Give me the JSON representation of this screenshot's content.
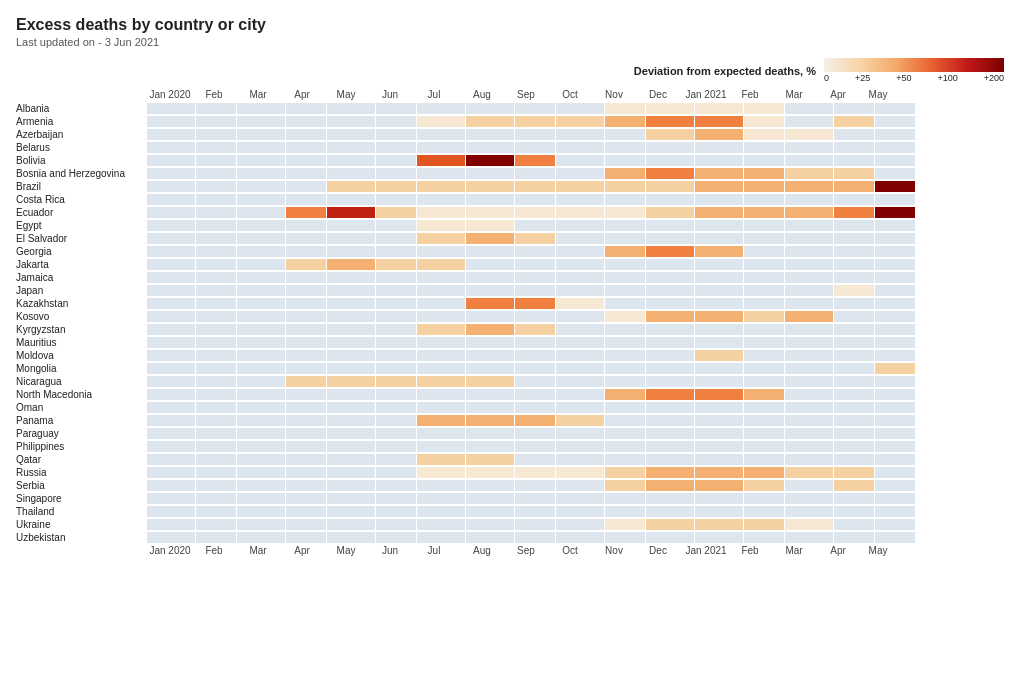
{
  "title": "Excess deaths by country or city",
  "subtitle": "Last updated on -  3 Jun 2021",
  "legend": {
    "title": "Deviation from expected deaths, %",
    "ticks": [
      "0",
      "+25",
      "+50",
      "+100",
      "+200"
    ]
  },
  "months": [
    {
      "label": "Jan 2020",
      "width": 48
    },
    {
      "label": "Feb",
      "width": 40
    },
    {
      "label": "Mar",
      "width": 48
    },
    {
      "label": "Apr",
      "width": 40
    },
    {
      "label": "May",
      "width": 48
    },
    {
      "label": "Jun",
      "width": 40
    },
    {
      "label": "Jul",
      "width": 48
    },
    {
      "label": "Aug",
      "width": 48
    },
    {
      "label": "Sep",
      "width": 40
    },
    {
      "label": "Oct",
      "width": 48
    },
    {
      "label": "Nov",
      "width": 40
    },
    {
      "label": "Dec",
      "width": 48
    },
    {
      "label": "Jan 2021",
      "width": 48
    },
    {
      "label": "Feb",
      "width": 40
    },
    {
      "label": "Mar",
      "width": 48
    },
    {
      "label": "Apr",
      "width": 40
    },
    {
      "label": "May",
      "width": 40
    }
  ],
  "countries": [
    {
      "name": "Albania",
      "cells": [
        0,
        0,
        0,
        0,
        0,
        0,
        0,
        0,
        0,
        0,
        5,
        15,
        20,
        10,
        0,
        0,
        0
      ]
    },
    {
      "name": "Armenia",
      "cells": [
        0,
        0,
        0,
        0,
        0,
        0,
        20,
        30,
        30,
        25,
        60,
        90,
        80,
        20,
        0,
        40,
        0
      ]
    },
    {
      "name": "Azerbaijan",
      "cells": [
        0,
        0,
        0,
        0,
        0,
        0,
        0,
        0,
        0,
        0,
        0,
        30,
        50,
        20,
        15,
        0,
        0
      ]
    },
    {
      "name": "Belarus",
      "cells": [
        0,
        0,
        0,
        0,
        0,
        0,
        0,
        0,
        0,
        0,
        0,
        0,
        0,
        0,
        0,
        0,
        0
      ]
    },
    {
      "name": "Bolivia",
      "cells": [
        0,
        0,
        0,
        0,
        0,
        0,
        110,
        170,
        80,
        0,
        0,
        0,
        0,
        0,
        0,
        0,
        0
      ]
    },
    {
      "name": "Bosnia and Herzegovina",
      "cells": [
        0,
        0,
        0,
        0,
        0,
        0,
        0,
        0,
        0,
        0,
        60,
        80,
        70,
        50,
        40,
        30,
        0
      ]
    },
    {
      "name": "Brazil",
      "cells": [
        0,
        0,
        0,
        0,
        25,
        30,
        30,
        30,
        30,
        30,
        35,
        40,
        50,
        55,
        60,
        65,
        200
      ]
    },
    {
      "name": "Costa Rica",
      "cells": [
        0,
        0,
        0,
        0,
        0,
        0,
        0,
        0,
        0,
        0,
        0,
        0,
        0,
        0,
        0,
        0,
        0
      ]
    },
    {
      "name": "Ecuador",
      "cells": [
        0,
        0,
        0,
        100,
        160,
        40,
        20,
        15,
        10,
        10,
        10,
        30,
        50,
        60,
        70,
        80,
        200
      ]
    },
    {
      "name": "Egypt",
      "cells": [
        0,
        0,
        0,
        0,
        0,
        0,
        20,
        10,
        0,
        0,
        0,
        0,
        0,
        0,
        0,
        0,
        0
      ]
    },
    {
      "name": "El Salvador",
      "cells": [
        0,
        0,
        0,
        0,
        0,
        0,
        40,
        60,
        30,
        0,
        0,
        0,
        0,
        0,
        0,
        0,
        0
      ]
    },
    {
      "name": "Georgia",
      "cells": [
        0,
        0,
        0,
        0,
        0,
        0,
        0,
        0,
        0,
        0,
        60,
        90,
        60,
        0,
        0,
        0,
        0
      ]
    },
    {
      "name": "Jakarta",
      "cells": [
        0,
        0,
        0,
        30,
        50,
        40,
        30,
        0,
        0,
        0,
        0,
        0,
        0,
        0,
        0,
        0,
        0
      ]
    },
    {
      "name": "Jamaica",
      "cells": [
        0,
        0,
        0,
        0,
        0,
        0,
        0,
        0,
        0,
        0,
        0,
        0,
        0,
        0,
        0,
        0,
        0
      ]
    },
    {
      "name": "Japan",
      "cells": [
        0,
        0,
        0,
        0,
        0,
        0,
        0,
        0,
        0,
        0,
        0,
        0,
        0,
        0,
        0,
        15,
        0
      ]
    },
    {
      "name": "Kazakhstan",
      "cells": [
        0,
        0,
        0,
        0,
        0,
        0,
        0,
        90,
        80,
        20,
        0,
        0,
        0,
        0,
        0,
        0,
        0
      ]
    },
    {
      "name": "Kosovo",
      "cells": [
        0,
        0,
        0,
        0,
        0,
        0,
        0,
        0,
        0,
        0,
        20,
        60,
        50,
        40,
        50,
        0,
        0
      ]
    },
    {
      "name": "Kyrgyzstan",
      "cells": [
        0,
        0,
        0,
        0,
        0,
        0,
        30,
        60,
        30,
        0,
        0,
        0,
        0,
        0,
        0,
        0,
        0
      ]
    },
    {
      "name": "Mauritius",
      "cells": [
        0,
        0,
        0,
        0,
        0,
        0,
        0,
        0,
        0,
        0,
        0,
        0,
        0,
        0,
        0,
        0,
        0
      ]
    },
    {
      "name": "Moldova",
      "cells": [
        0,
        0,
        0,
        0,
        0,
        0,
        0,
        0,
        0,
        0,
        0,
        0,
        30,
        0,
        0,
        0,
        0
      ]
    },
    {
      "name": "Mongolia",
      "cells": [
        0,
        0,
        0,
        0,
        0,
        0,
        0,
        0,
        0,
        0,
        0,
        0,
        0,
        0,
        0,
        0,
        40
      ]
    },
    {
      "name": "Nicaragua",
      "cells": [
        0,
        0,
        0,
        30,
        40,
        40,
        40,
        30,
        0,
        0,
        0,
        0,
        0,
        0,
        0,
        0,
        0
      ]
    },
    {
      "name": "North Macedonia",
      "cells": [
        0,
        0,
        0,
        0,
        0,
        0,
        0,
        0,
        0,
        0,
        60,
        100,
        80,
        50,
        0,
        0,
        0
      ]
    },
    {
      "name": "Oman",
      "cells": [
        0,
        0,
        0,
        0,
        0,
        0,
        0,
        0,
        0,
        0,
        0,
        0,
        0,
        0,
        0,
        0,
        0
      ]
    },
    {
      "name": "Panama",
      "cells": [
        0,
        0,
        0,
        0,
        0,
        0,
        50,
        70,
        60,
        30,
        0,
        0,
        0,
        0,
        0,
        0,
        0
      ]
    },
    {
      "name": "Paraguay",
      "cells": [
        0,
        0,
        0,
        0,
        0,
        0,
        0,
        0,
        0,
        0,
        0,
        0,
        0,
        0,
        0,
        0,
        0
      ]
    },
    {
      "name": "Philippines",
      "cells": [
        0,
        0,
        0,
        0,
        0,
        0,
        0,
        0,
        0,
        0,
        0,
        0,
        0,
        0,
        0,
        0,
        0
      ]
    },
    {
      "name": "Qatar",
      "cells": [
        0,
        0,
        0,
        0,
        0,
        0,
        35,
        30,
        0,
        0,
        0,
        0,
        0,
        0,
        0,
        0,
        0
      ]
    },
    {
      "name": "Russia",
      "cells": [
        0,
        0,
        0,
        0,
        0,
        0,
        15,
        20,
        15,
        20,
        35,
        55,
        60,
        55,
        45,
        40,
        0
      ]
    },
    {
      "name": "Serbia",
      "cells": [
        0,
        0,
        0,
        0,
        0,
        0,
        0,
        0,
        0,
        0,
        30,
        70,
        60,
        40,
        0,
        40,
        0
      ]
    },
    {
      "name": "Singapore",
      "cells": [
        0,
        0,
        0,
        0,
        0,
        0,
        0,
        0,
        0,
        0,
        0,
        0,
        0,
        0,
        0,
        0,
        0
      ]
    },
    {
      "name": "Thailand",
      "cells": [
        0,
        0,
        0,
        0,
        0,
        0,
        0,
        0,
        0,
        0,
        0,
        0,
        0,
        0,
        0,
        0,
        0
      ]
    },
    {
      "name": "Ukraine",
      "cells": [
        0,
        0,
        0,
        0,
        0,
        0,
        0,
        0,
        0,
        0,
        20,
        40,
        40,
        30,
        20,
        0,
        0
      ]
    },
    {
      "name": "Uzbekistan",
      "cells": [
        0,
        0,
        0,
        0,
        0,
        0,
        0,
        0,
        0,
        0,
        0,
        0,
        0,
        0,
        0,
        0,
        0
      ]
    }
  ]
}
